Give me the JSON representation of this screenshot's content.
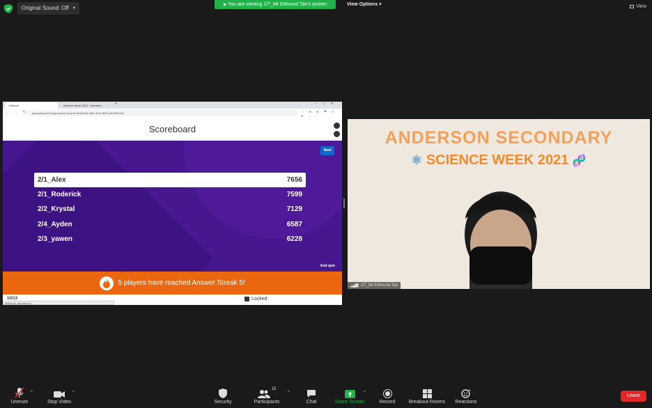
{
  "top": {
    "original_sound": "Original Sound: Off",
    "viewing_banner": "You are viewing 1/7_Mr Edmund Tan's screen",
    "view_options": "View Options",
    "view": "View"
  },
  "share": {
    "tabs": [
      "Kahoot!",
      "Science Week 2021 - Interdisc..."
    ],
    "url": "play.kahoot.it/v2/gameblock?quizId=8e0c6c3c-ff06-401e-8f05-a4b7f82cafd",
    "scoreboard_title": "Scoreboard",
    "next_label": "Next",
    "leaderboard": [
      {
        "name": "2/1_Alex",
        "score": "7656"
      },
      {
        "name": "2/1_Roderick",
        "score": "7599"
      },
      {
        "name": "2/2_Krystal",
        "score": "7129"
      },
      {
        "name": "2/4_Ayden",
        "score": "6587"
      },
      {
        "name": "2/3_yawen",
        "score": "6228"
      }
    ],
    "end_quiz": "End quiz",
    "streak_message": "5 players have reached Answer Streak 5!",
    "question_count": "10/13",
    "status_text": "Waiting for play.kahoot.it...",
    "locked": "Locked"
  },
  "video": {
    "title_line1": "ANDERSON SECONDARY",
    "title_line2": "SCIENCE WEEK 2021",
    "participant_name": "1/7_Mr Edmund Tan"
  },
  "toolbar": {
    "unmute": "Unmute",
    "stop_video": "Stop Video",
    "security": "Security",
    "participants": "Participants",
    "participants_count": "15",
    "chat": "Chat",
    "share_screen": "Share Screen",
    "record": "Record",
    "breakout_rooms": "Breakout Rooms",
    "reactions": "Reactions",
    "leave": "Leave"
  },
  "colors": {
    "kahoot_purple": "#46178f",
    "streak_orange": "#eb670f",
    "share_green": "#22b24c",
    "leave_red": "#e02828"
  }
}
